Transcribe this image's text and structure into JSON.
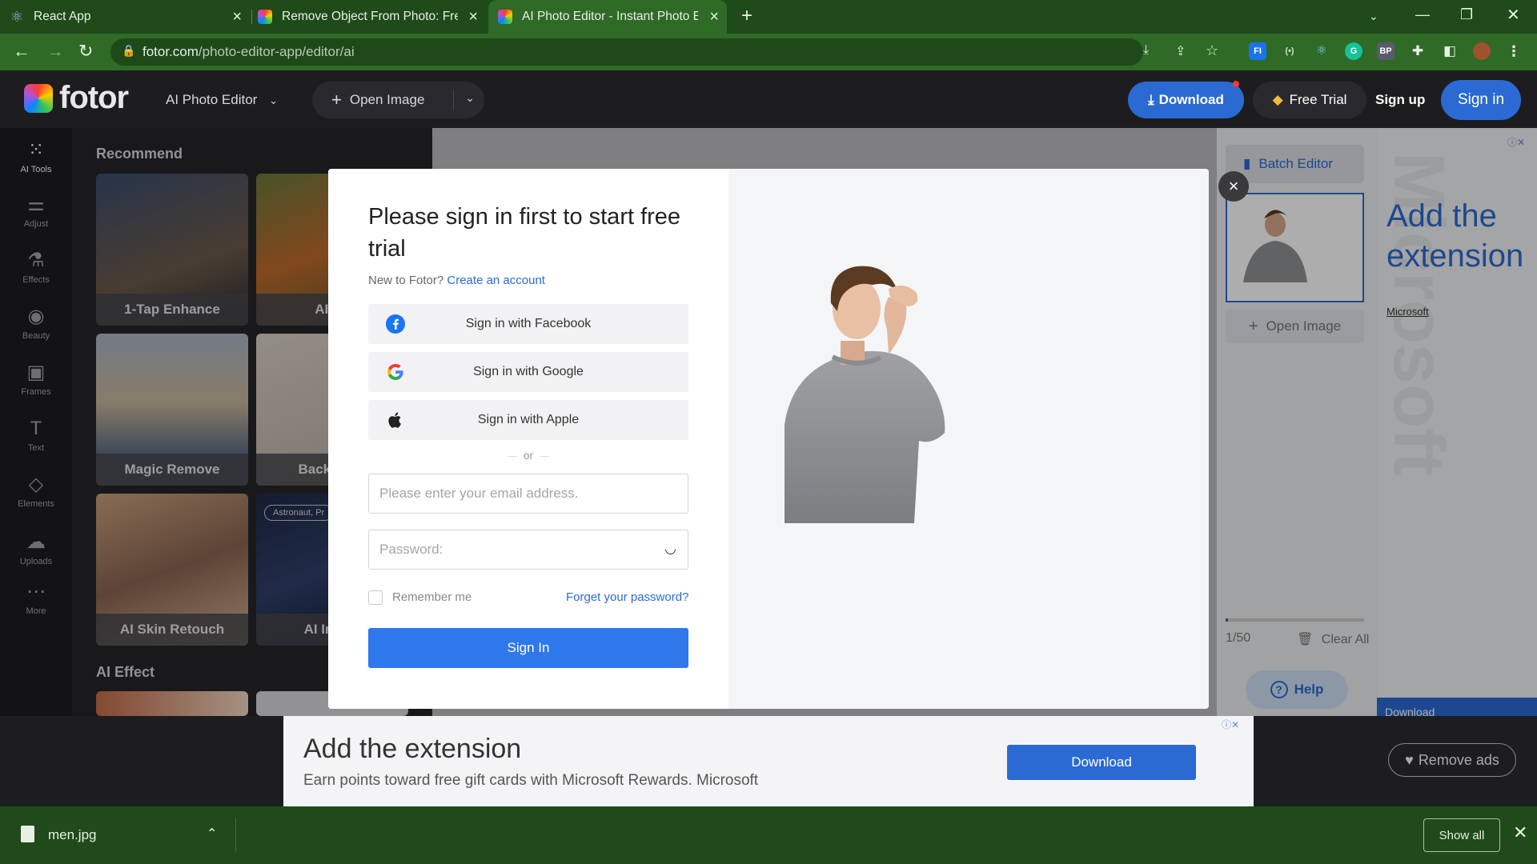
{
  "browser": {
    "tabs": [
      {
        "title": "React App",
        "fav_color": "#5a6b58"
      },
      {
        "title": "Remove Object From Photo: Free",
        "fav_color": "#e84e3c"
      },
      {
        "title": "AI Photo Editor - Instant Photo E",
        "fav_color": "#f4b400"
      }
    ],
    "url_host": "fotor.com",
    "url_path": "/photo-editor-app/editor/ai"
  },
  "header": {
    "logo_text": "fotor",
    "mode_select": "AI Photo Editor",
    "open_image": "Open Image",
    "download": "Download",
    "free_trial": "Free Trial",
    "sign_up": "Sign up",
    "sign_in": "Sign in"
  },
  "rail": [
    {
      "label": "AI Tools",
      "icon": "grid-icon"
    },
    {
      "label": "Adjust",
      "icon": "sliders-icon"
    },
    {
      "label": "Effects",
      "icon": "flask-icon"
    },
    {
      "label": "Beauty",
      "icon": "eye-icon"
    },
    {
      "label": "Frames",
      "icon": "frame-icon"
    },
    {
      "label": "Text",
      "icon": "text-icon"
    },
    {
      "label": "Elements",
      "icon": "shapes-icon"
    },
    {
      "label": "Uploads",
      "icon": "upload-cloud-icon"
    },
    {
      "label": "More",
      "icon": "more-icon"
    }
  ],
  "panel": {
    "recommend_title": "Recommend",
    "cards": [
      "1-Tap Enhance",
      "AI En",
      "Magic Remove",
      "Backgrour",
      "AI Skin Retouch",
      "AI Image"
    ],
    "card_badge": "Astronaut, Pr",
    "effect_title": "AI Effect"
  },
  "right": {
    "batch_editor": "Batch Editor",
    "open_image": "Open Image",
    "count": "1/50",
    "clear_all": "Clear All",
    "help": "Help",
    "progress_fraction": 0.02
  },
  "side_ad": {
    "headline": "Add the extension",
    "source": "Microsoft",
    "watermark": "Microsoft",
    "cta": "Download"
  },
  "bottom_ad": {
    "headline": "Add the extension",
    "sub": "Earn points toward free gift cards with Microsoft Rewards. Microsoft",
    "button": "Download",
    "remove_ads": "Remove ads"
  },
  "modal": {
    "title": "Please sign in first to start free trial",
    "new_prompt": "New to Fotor?",
    "create_account": "Create an account",
    "facebook": "Sign in with Facebook",
    "google": "Sign in with Google",
    "apple": "Sign in with Apple",
    "or": "or",
    "email_placeholder": "Please enter your email address.",
    "password_placeholder": "Password:",
    "remember": "Remember me",
    "forgot": "Forget your password?",
    "submit": "Sign In"
  },
  "shelf": {
    "filename": "men.jpg",
    "show_all": "Show all"
  },
  "colors": {
    "accent": "#2b6ad3",
    "chrome": "#2f6a26"
  }
}
